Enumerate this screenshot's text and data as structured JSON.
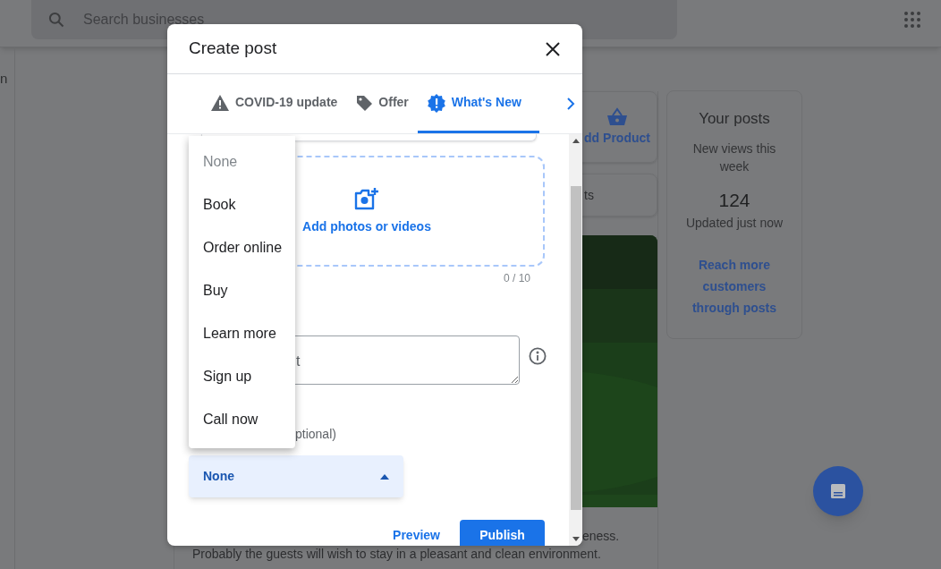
{
  "search": {
    "placeholder": "Search businesses"
  },
  "sidebar": {
    "text": "n"
  },
  "cards": [
    {
      "label": "dd Product"
    },
    {
      "label": "ts"
    }
  ],
  "post_excerpt": [
    "eness.",
    "Probably the guests will wish to stay in a pleasant and clean environment."
  ],
  "posts_card": {
    "title": "Your posts",
    "subtitle": "New views this week",
    "count": "124",
    "updated": "Updated just now",
    "link": "Reach more customers through posts"
  },
  "dialog": {
    "title": "Create post",
    "tabs": [
      {
        "label": "COVID-19 update",
        "kind": "warning",
        "selected": false
      },
      {
        "label": "Offer",
        "kind": "tag",
        "selected": false
      },
      {
        "label": "What's New",
        "kind": "news",
        "selected": true
      }
    ],
    "media": {
      "label": "Add photos or videos",
      "count": "0 / 10"
    },
    "text_field": {
      "placeholder": "t"
    },
    "button_label": "ptional)",
    "select": {
      "value": "None",
      "open": true
    },
    "menu": [
      {
        "label": "None",
        "disabled": true
      },
      {
        "label": "Book",
        "disabled": false
      },
      {
        "label": "Order online",
        "disabled": false
      },
      {
        "label": "Buy",
        "disabled": false
      },
      {
        "label": "Learn more",
        "disabled": false
      },
      {
        "label": "Sign up",
        "disabled": false
      },
      {
        "label": "Call now",
        "disabled": false
      }
    ],
    "actions": {
      "preview": "Preview",
      "publish": "Publish"
    }
  }
}
